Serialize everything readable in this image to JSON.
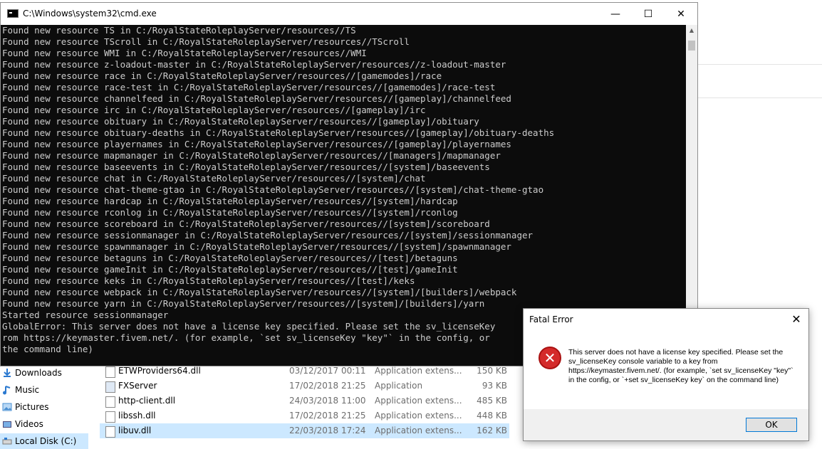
{
  "cmd": {
    "title": "C:\\Windows\\system32\\cmd.exe",
    "controls": {
      "minimize": "—",
      "maximize": "☐",
      "close": "✕"
    },
    "lines": [
      "Found new resource TS in C:/RoyalStateRoleplayServer/resources//TS",
      "Found new resource TScroll in C:/RoyalStateRoleplayServer/resources//TScroll",
      "Found new resource WMI in C:/RoyalStateRoleplayServer/resources//WMI",
      "Found new resource z-loadout-master in C:/RoyalStateRoleplayServer/resources//z-loadout-master",
      "Found new resource race in C:/RoyalStateRoleplayServer/resources//[gamemodes]/race",
      "Found new resource race-test in C:/RoyalStateRoleplayServer/resources//[gamemodes]/race-test",
      "Found new resource channelfeed in C:/RoyalStateRoleplayServer/resources//[gameplay]/channelfeed",
      "Found new resource irc in C:/RoyalStateRoleplayServer/resources//[gameplay]/irc",
      "Found new resource obituary in C:/RoyalStateRoleplayServer/resources//[gameplay]/obituary",
      "Found new resource obituary-deaths in C:/RoyalStateRoleplayServer/resources//[gameplay]/obituary-deaths",
      "Found new resource playernames in C:/RoyalStateRoleplayServer/resources//[gameplay]/playernames",
      "Found new resource mapmanager in C:/RoyalStateRoleplayServer/resources//[managers]/mapmanager",
      "Found new resource baseevents in C:/RoyalStateRoleplayServer/resources//[system]/baseevents",
      "Found new resource chat in C:/RoyalStateRoleplayServer/resources//[system]/chat",
      "Found new resource chat-theme-gtao in C:/RoyalStateRoleplayServer/resources//[system]/chat-theme-gtao",
      "Found new resource hardcap in C:/RoyalStateRoleplayServer/resources//[system]/hardcap",
      "Found new resource rconlog in C:/RoyalStateRoleplayServer/resources//[system]/rconlog",
      "Found new resource scoreboard in C:/RoyalStateRoleplayServer/resources//[system]/scoreboard",
      "Found new resource sessionmanager in C:/RoyalStateRoleplayServer/resources//[system]/sessionmanager",
      "Found new resource spawnmanager in C:/RoyalStateRoleplayServer/resources//[system]/spawnmanager",
      "Found new resource betaguns in C:/RoyalStateRoleplayServer/resources//[test]/betaguns",
      "Found new resource gameInit in C:/RoyalStateRoleplayServer/resources//[test]/gameInit",
      "Found new resource keks in C:/RoyalStateRoleplayServer/resources//[test]/keks",
      "Found new resource webpack in C:/RoyalStateRoleplayServer/resources//[system]/[builders]/webpack",
      "Found new resource yarn in C:/RoyalStateRoleplayServer/resources//[system]/[builders]/yarn",
      "Started resource sessionmanager",
      "GlobalError: This server does not have a license key specified. Please set the sv_licenseKey",
      "rom https://keymaster.fivem.net/. (for example, `set sv_licenseKey \"key\"` in the config, or",
      "the command line)"
    ]
  },
  "explorer": {
    "nav": [
      {
        "label": "Downloads",
        "icon": "download-icon",
        "selected": false
      },
      {
        "label": "Music",
        "icon": "music-icon",
        "selected": false
      },
      {
        "label": "Pictures",
        "icon": "pictures-icon",
        "selected": false
      },
      {
        "label": "Videos",
        "icon": "videos-icon",
        "selected": false
      },
      {
        "label": "Local Disk (C:)",
        "icon": "drive-icon",
        "selected": true
      }
    ],
    "files": [
      {
        "name": "ETWProviders64.dll",
        "date": "03/12/2017 00:11",
        "type": "Application extens...",
        "size": "150 KB",
        "selected": false
      },
      {
        "name": "FXServer",
        "date": "17/02/2018 21:25",
        "type": "Application",
        "size": "93 KB",
        "selected": false
      },
      {
        "name": "http-client.dll",
        "date": "24/03/2018 11:00",
        "type": "Application extens...",
        "size": "485 KB",
        "selected": false
      },
      {
        "name": "libssh.dll",
        "date": "17/02/2018 21:25",
        "type": "Application extens...",
        "size": "448 KB",
        "selected": false
      },
      {
        "name": "libuv.dll",
        "date": "22/03/2018 17:24",
        "type": "Application extens...",
        "size": "162 KB",
        "selected": true
      }
    ]
  },
  "dialog": {
    "title": "Fatal Error",
    "close": "✕",
    "icon": "error-icon",
    "icon_glyph": "✕",
    "message": "This server does not have a license key specified. Please set the sv_licenseKey console variable to a key from https://keymaster.fivem.net/. (for example, `set sv_licenseKey \"key\"` in the config, or `+set sv_licenseKey key` on the command line)",
    "ok_label": "OK"
  }
}
